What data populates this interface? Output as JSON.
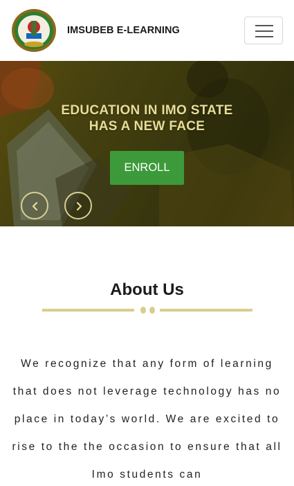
{
  "header": {
    "brand": "IMSUBEB E-LEARNING",
    "logo_icon": "imsubeb-crest-logo",
    "menu_icon": "hamburger-menu-icon"
  },
  "hero": {
    "title_line1": "EDUCATION IN IMO STATE",
    "title_line2": "HAS A NEW FACE",
    "enroll_label": "ENROLL",
    "prev_icon": "chevron-left-icon",
    "next_icon": "chevron-right-icon"
  },
  "about": {
    "title": "About Us",
    "text": "We recognize that any form of learning that does not leverage technology has no place in today’s world. We are excited to rise to the the occasion to ensure that all Imo students can"
  },
  "colors": {
    "accent_gold": "#d9cd8b",
    "button_green": "#3d9a3a",
    "hero_text": "#e8dc9a"
  }
}
